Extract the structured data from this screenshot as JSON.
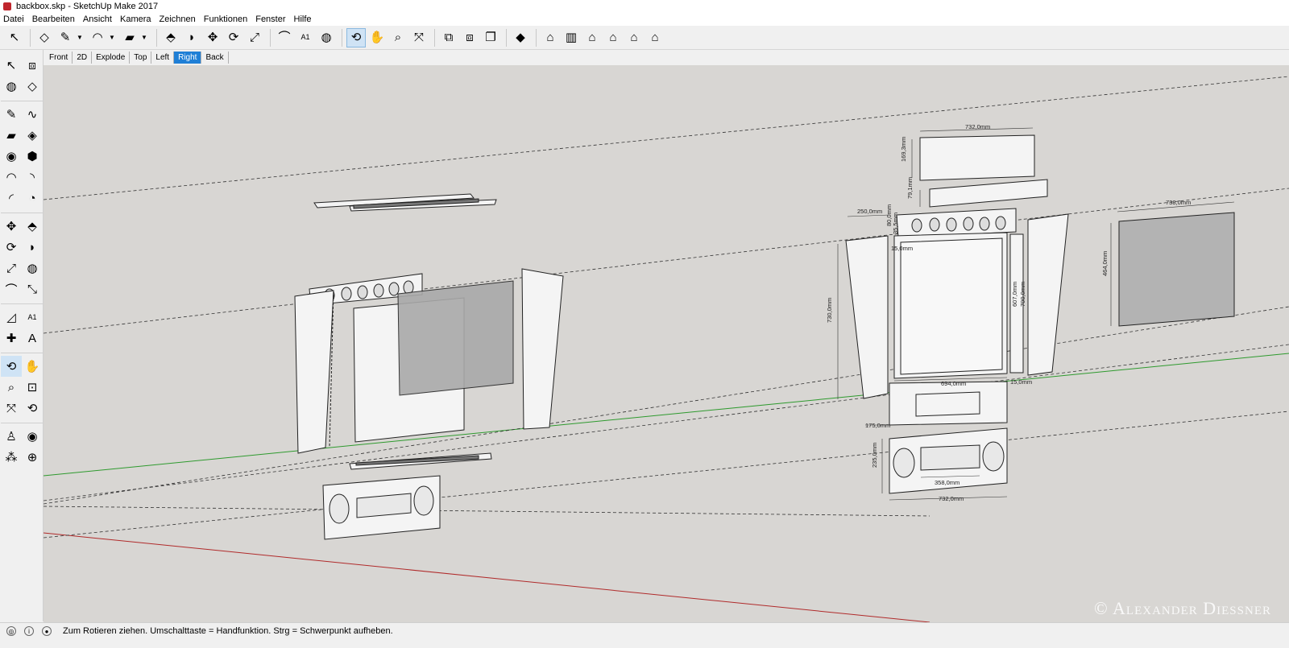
{
  "window": {
    "title": "backbox.skp - SketchUp Make 2017"
  },
  "menu": [
    "Datei",
    "Bearbeiten",
    "Ansicht",
    "Kamera",
    "Zeichnen",
    "Funktionen",
    "Fenster",
    "Hilfe"
  ],
  "toolbar": {
    "groups": [
      [
        {
          "name": "select-tool-icon",
          "glyph": "↖"
        }
      ],
      [
        {
          "name": "eraser-icon",
          "glyph": "◇"
        },
        {
          "name": "pencil-line-icon",
          "glyph": "✎"
        },
        {
          "name": "arc-icon",
          "glyph": "◠"
        },
        {
          "name": "rectangle-icon",
          "glyph": "▰"
        }
      ],
      [
        {
          "name": "push-pull-icon",
          "glyph": "⬘"
        },
        {
          "name": "follow-me-icon",
          "glyph": "◗"
        },
        {
          "name": "move-icon",
          "glyph": "✥"
        },
        {
          "name": "rotate-icon",
          "glyph": "⟳"
        },
        {
          "name": "scale-icon",
          "glyph": "⤢"
        }
      ],
      [
        {
          "name": "tape-measure-icon",
          "glyph": "⌒"
        },
        {
          "name": "text-icon",
          "glyph": "A1"
        },
        {
          "name": "paint-bucket-icon",
          "glyph": "◍"
        }
      ],
      [
        {
          "name": "orbit-icon",
          "glyph": "⟲",
          "active": true
        },
        {
          "name": "pan-icon",
          "glyph": "✋"
        },
        {
          "name": "zoom-icon",
          "glyph": "⌕"
        },
        {
          "name": "zoom-extents-icon",
          "glyph": "⤧"
        }
      ],
      [
        {
          "name": "warehouse-icon",
          "glyph": "⧉"
        },
        {
          "name": "share-model-icon",
          "glyph": "⧈"
        },
        {
          "name": "extension-icon",
          "glyph": "❐"
        }
      ],
      [
        {
          "name": "ruby-icon",
          "glyph": "◆"
        }
      ],
      [
        {
          "name": "iso-view-icon",
          "glyph": "⌂"
        },
        {
          "name": "top-view-icon",
          "glyph": "▥"
        },
        {
          "name": "front-view-icon",
          "glyph": "⌂"
        },
        {
          "name": "right-view-icon",
          "glyph": "⌂"
        },
        {
          "name": "back-view-icon",
          "glyph": "⌂"
        },
        {
          "name": "left-view-icon",
          "glyph": "⌂"
        }
      ]
    ]
  },
  "scenes": [
    {
      "label": "Front"
    },
    {
      "label": "2D"
    },
    {
      "label": "Explode"
    },
    {
      "label": "Top"
    },
    {
      "label": "Left"
    },
    {
      "label": "Right",
      "active": true
    },
    {
      "label": "Back"
    }
  ],
  "palette": [
    [
      "select-icon",
      "↖"
    ],
    [
      "make-component-icon",
      "⧈"
    ],
    [
      "paint-icon",
      "◍"
    ],
    [
      "erase-icon",
      "◇"
    ],
    [
      "line-icon",
      "✎"
    ],
    [
      "freehand-icon",
      "∿"
    ],
    [
      "rectangle-icon",
      "▰"
    ],
    [
      "rotated-rectangle-icon",
      "◈"
    ],
    [
      "circle-icon",
      "◉"
    ],
    [
      "polygon-icon",
      "⬢"
    ],
    [
      "arc-icon",
      "◠"
    ],
    [
      "two-point-arc-icon",
      "◝"
    ],
    [
      "three-point-arc-icon",
      "◜"
    ],
    [
      "pie-icon",
      "◔"
    ],
    [
      "move-icon",
      "✥"
    ],
    [
      "push-pull-icon",
      "⬘"
    ],
    [
      "rotate-icon",
      "⟳"
    ],
    [
      "follow-me-icon",
      "◗"
    ],
    [
      "scale-icon",
      "⤢"
    ],
    [
      "offset-icon",
      "◍"
    ],
    [
      "tape-measure-icon",
      "⌒"
    ],
    [
      "dimension-icon",
      "⤡"
    ],
    [
      "protractor-icon",
      "◿"
    ],
    [
      "text-icon",
      "A1"
    ],
    [
      "axes-icon",
      "✚"
    ],
    [
      "3d-text-icon",
      "A"
    ],
    [
      "orbit-icon",
      "⟲"
    ],
    [
      "pan-icon",
      "✋"
    ],
    [
      "zoom-icon",
      "⌕"
    ],
    [
      "zoom-window-icon",
      "⊡"
    ],
    [
      "zoom-extents-icon",
      "⤧"
    ],
    [
      "previous-view-icon",
      "⟲"
    ],
    [
      "position-camera-icon",
      "♙"
    ],
    [
      "look-around-icon",
      "◉"
    ],
    [
      "walk-icon",
      "⁂"
    ],
    [
      "section-plane-icon",
      "⊕"
    ]
  ],
  "dimensions": [
    "732,0mm",
    "169,3mm",
    "79,1mm",
    "250,0mm",
    "80,0mm",
    "35,5mm",
    "15,0mm",
    "730,0mm",
    "694,0mm",
    "607,0mm",
    "700,0mm",
    "15,0mm",
    "175,0mm",
    "738,0mm",
    "464,0mm",
    "235,0mm",
    "358,0mm",
    "732,0mm"
  ],
  "watermark": "© Alexander Diessner",
  "status": {
    "text": "Zum Rotieren ziehen. Umschalttaste = Handfunktion. Strg = Schwerpunkt aufheben."
  }
}
